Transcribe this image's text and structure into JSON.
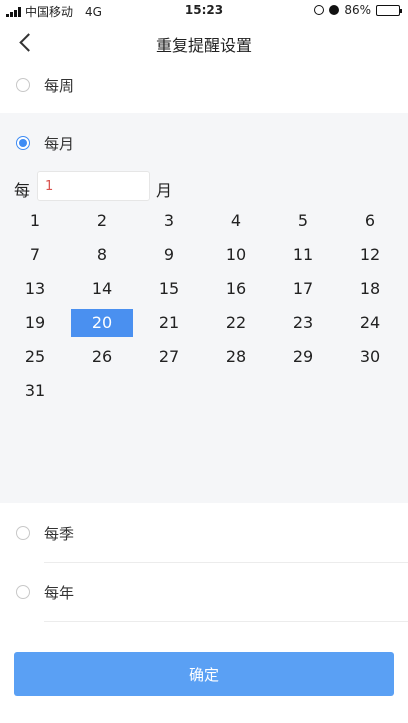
{
  "status_bar": {
    "carrier": "中国移动",
    "network": "4G",
    "time": "15:23",
    "battery": "86%",
    "battery_level": 0.86
  },
  "nav": {
    "title": "重复提醒设置",
    "back_icon": "chevron-left-icon"
  },
  "options": {
    "weekly": "每周",
    "monthly": "每月",
    "quarterly": "每季",
    "yearly": "每年",
    "selected": "monthly"
  },
  "monthly": {
    "every_label": "每",
    "interval_value": "1",
    "unit_label": "月",
    "selected_day": "20",
    "days": [
      "1",
      "2",
      "3",
      "4",
      "5",
      "6",
      "7",
      "8",
      "9",
      "10",
      "11",
      "12",
      "13",
      "14",
      "15",
      "16",
      "17",
      "18",
      "19",
      "20",
      "21",
      "22",
      "23",
      "24",
      "25",
      "26",
      "27",
      "28",
      "29",
      "30",
      "31"
    ]
  },
  "confirm_label": "确定",
  "colors": {
    "accent": "#4a90f0",
    "button": "#5aa0f4",
    "input_text": "#d9534f"
  }
}
